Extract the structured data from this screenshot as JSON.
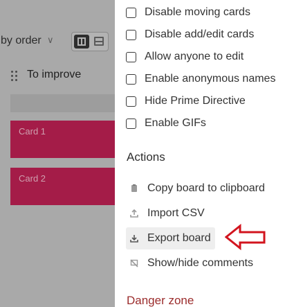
{
  "board": {
    "sort_label": "by order",
    "column_title": "To improve",
    "cards": [
      {
        "label": "Card 1"
      },
      {
        "label": "Card 2"
      }
    ]
  },
  "options": [
    {
      "label": "Disable moving cards",
      "checked": false
    },
    {
      "label": "Disable add/edit cards",
      "checked": false
    },
    {
      "label": "Allow anyone to edit",
      "checked": false
    },
    {
      "label": "Enable anonymous names",
      "checked": false
    },
    {
      "label": "Hide Prime Directive",
      "checked": false
    },
    {
      "label": "Enable GIFs",
      "checked": false
    }
  ],
  "actions_title": "Actions",
  "actions": [
    {
      "label": "Copy board to clipboard",
      "icon": "clipboard-icon"
    },
    {
      "label": "Import CSV",
      "icon": "upload-icon"
    },
    {
      "label": "Export board",
      "icon": "download-icon"
    },
    {
      "label": "Show/hide comments",
      "icon": "comment-off-icon"
    }
  ],
  "danger_title": "Danger zone",
  "colors": {
    "card": "#a41c48",
    "danger": "#9b2c2c",
    "annotation_arrow": "#d2141e",
    "overlay": "#a9a9a9"
  }
}
